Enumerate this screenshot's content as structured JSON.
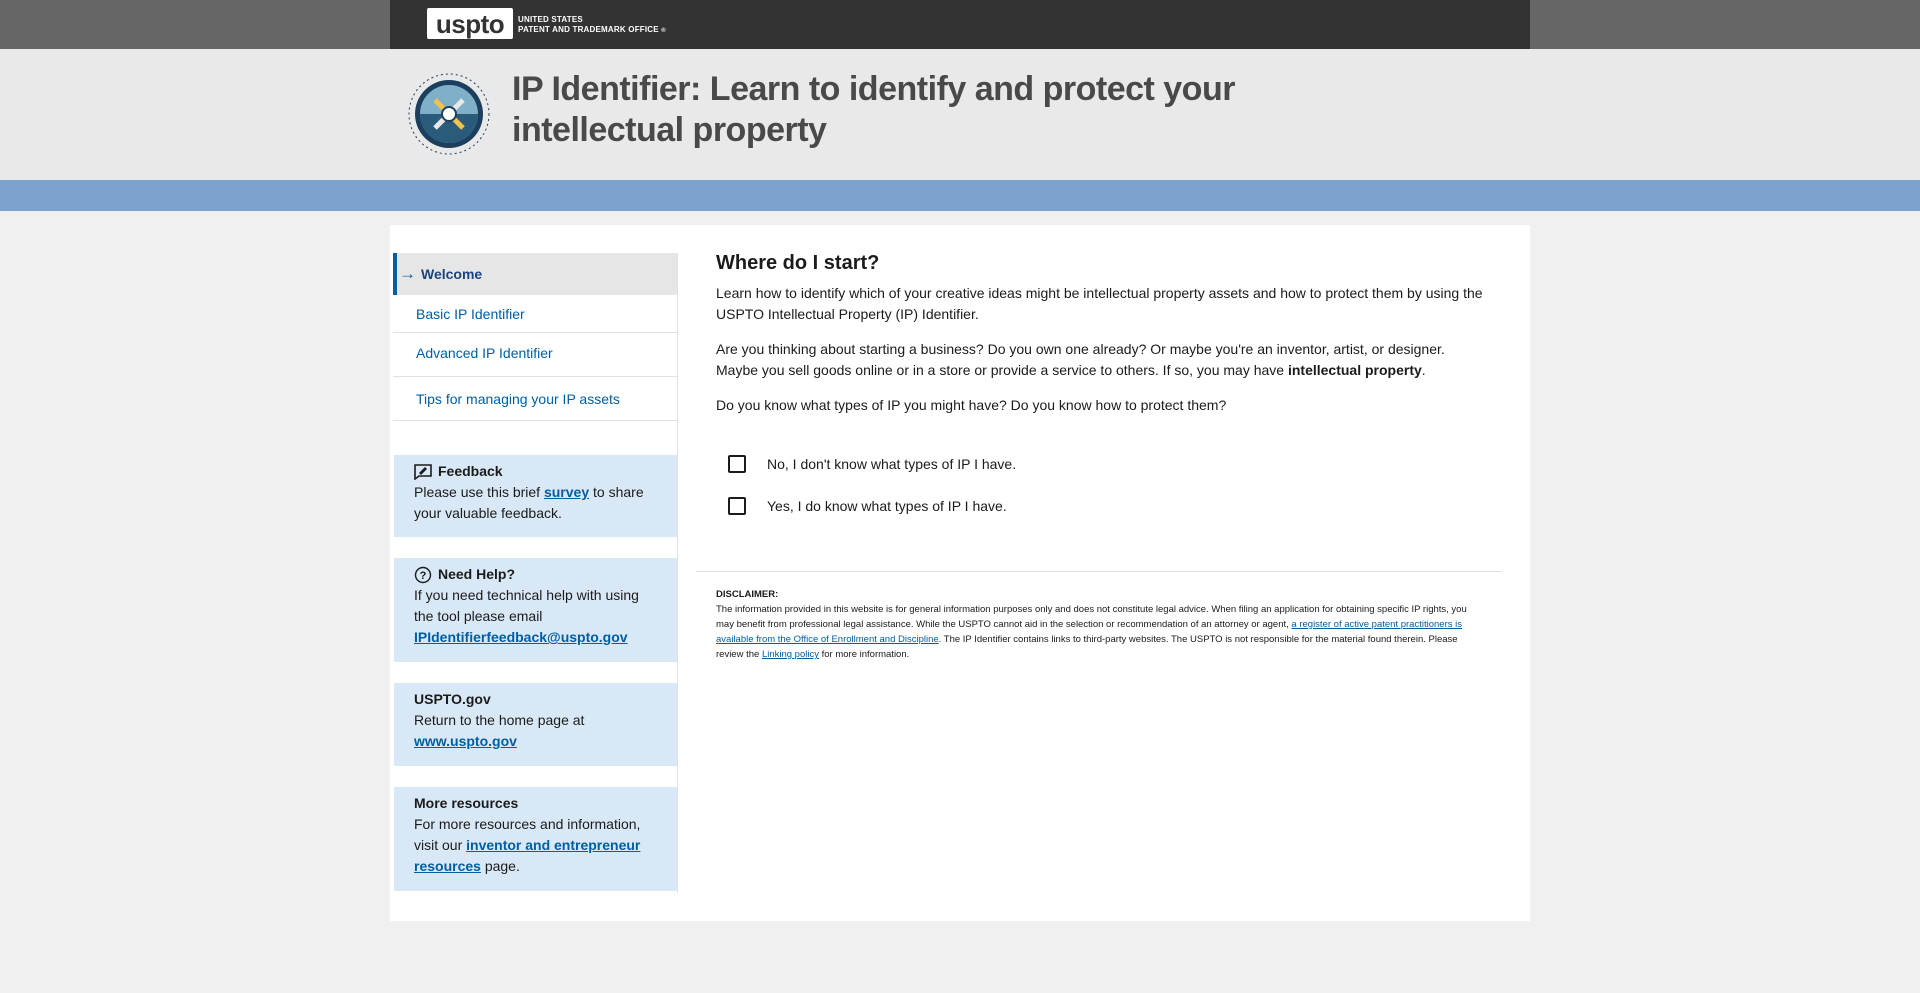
{
  "header": {
    "logo": "uspto",
    "agency_line1": "UNITED STATES",
    "agency_line2": "PATENT AND TRADEMARK OFFICE",
    "title": "IP Identifier: Learn to identify and protect your intellectual property",
    "emblem_text": "INTELLECTUAL PROPERTY IDENTIFIER"
  },
  "nav": {
    "welcome": "Welcome",
    "items": [
      "Basic IP Identifier",
      "Advanced IP Identifier",
      "Tips for managing your IP assets"
    ]
  },
  "feedback": {
    "title": "Feedback",
    "text_before": "Please use this brief ",
    "link": "survey",
    "text_after": " to share your valuable feedback."
  },
  "help": {
    "title": "Need Help?",
    "text": "If you need technical help with using the tool please email ",
    "email": "IPIdentifierfeedback@uspto.gov"
  },
  "uspto": {
    "title": "USPTO.gov",
    "text": "Return to the home page at ",
    "link": "www.uspto.gov"
  },
  "resources": {
    "title": "More resources",
    "text_before": "For more resources and information, visit our ",
    "link": "inventor and entrepreneur resources",
    "text_after": " page."
  },
  "main": {
    "heading": "Where do I start?",
    "intro": "Learn how to identify which of your creative ideas might be intellectual property assets and how to protect them by using the USPTO Intellectual Property (IP) Identifier.",
    "p2_before": "Are you thinking about starting a business? Do you own one already? Or maybe you're an inventor, artist, or designer. Maybe you sell goods online or in a store or provide a service to others. If so, you may have ",
    "p2_bold": "intellectual property",
    "p2_after": ".",
    "question": "Do you know what types of IP you might have? Do you know how to protect them?",
    "option_no": "No, I don't know what types of IP I have.",
    "option_yes": "Yes, I do know what types of IP I have."
  },
  "disclaimer": {
    "heading": "DISCLAIMER:",
    "text1": "The information provided in this website is for general information purposes only and does not constitute legal advice. When filing an application for obtaining specific IP rights, you may benefit from professional legal assistance. While the USPTO cannot aid in the selection or recommendation of an attorney or agent, ",
    "link1": "a register of active patent practitioners is available from the Office of Enrollment and Discipline",
    "text2": ". The IP Identifier contains links to third-party websites. The USPTO is not responsible for the material found therein. Please review the ",
    "link2": "Linking policy",
    "text3": " for more information."
  },
  "colors": {
    "primary_link": "#005ea2",
    "nav_active": "#1a4480",
    "sidebar_box": "#d9e8f6",
    "blue_band": "#7da3cc",
    "top_bar": "#333333"
  }
}
